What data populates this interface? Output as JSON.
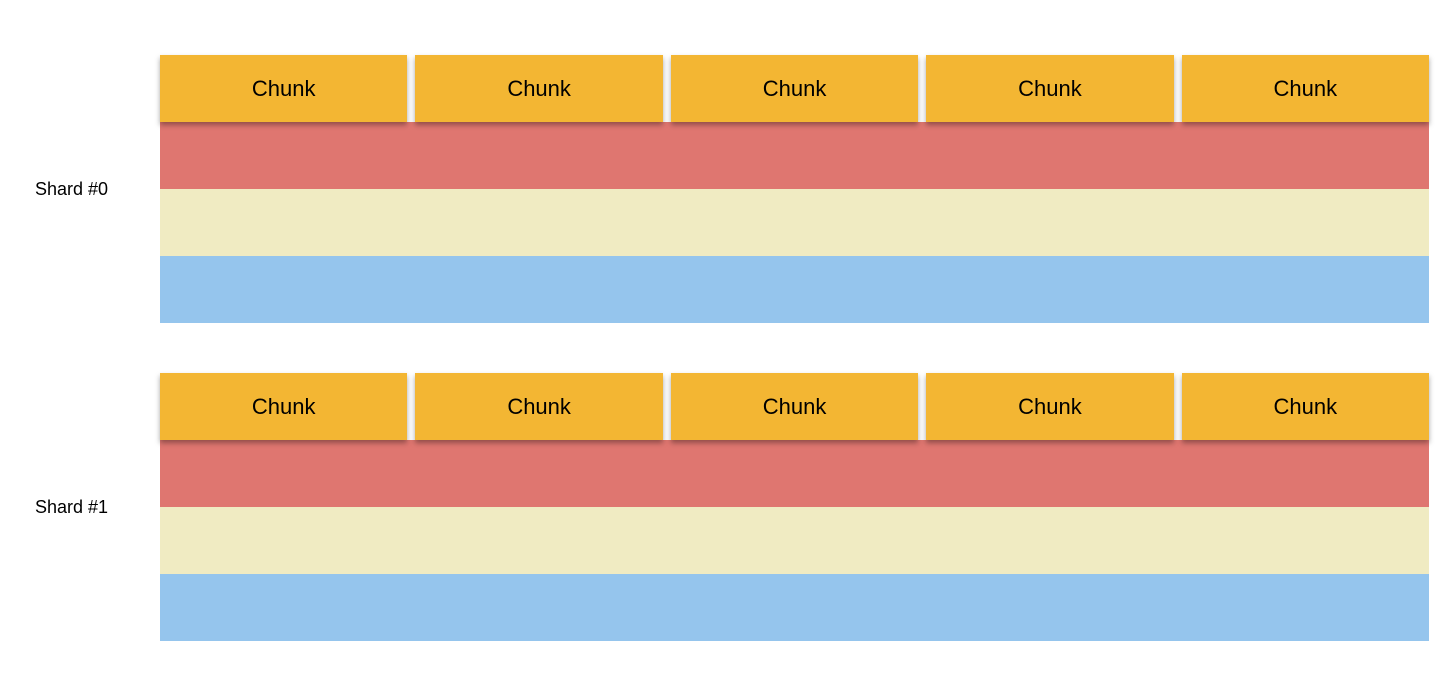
{
  "colors": {
    "chunk": "#F3B633",
    "bar1": "#DF7670",
    "bar2": "#F0EBC2",
    "bar3": "#95C5ED"
  },
  "shards": [
    {
      "label": "Shard #0",
      "chunks": [
        "Chunk",
        "Chunk",
        "Chunk",
        "Chunk",
        "Chunk"
      ]
    },
    {
      "label": "Shard #1",
      "chunks": [
        "Chunk",
        "Chunk",
        "Chunk",
        "Chunk",
        "Chunk"
      ]
    }
  ]
}
